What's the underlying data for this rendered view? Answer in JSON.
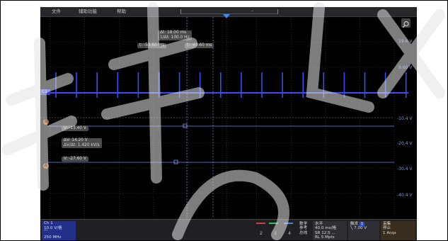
{
  "menu": {
    "file": "文件",
    "edit": "辅助功能",
    "help": "帮助"
  },
  "record_view": {
    "dash": "–"
  },
  "readouts": {
    "delta_t": "Δt:  18.00 ms",
    "inv_delta_t": "1/Δt:  100.0 Hz",
    "t1": "t:   -53.60 ms",
    "t2": "t:   -43.60 ms",
    "v_a": "V:   -13.40 V",
    "delta_v": "ΔV:      14.20 V",
    "dv_dt": "ΔV/Δt: 1.420 kV/s",
    "v_b": "V:   -27.60 V"
  },
  "vscale": [
    "19.6 V",
    "9.60 V",
    "-10.4 V",
    "-20.4 V",
    "-30.4 V",
    "-40.4 V"
  ],
  "markers": {
    "a": "B",
    "b": "A",
    "channel": "C1"
  },
  "channel_box": {
    "title": "Ch 1",
    "scale": "10.0 V/格",
    "coupling": "⌒",
    "bandwidth": "250 MHz"
  },
  "channel_buttons": [
    "2",
    "3",
    "4"
  ],
  "math_refs": {
    "l1": "数学",
    "l2": "参考",
    "l3": "总线"
  },
  "horizontal": {
    "title": "水平",
    "scale": "40.0 ms/格",
    "sample_rate": "SR 12.5 ...",
    "record_length": "RL 5 Mpts"
  },
  "trigger": {
    "title": "触发",
    "badge": "1",
    "slope": "╲",
    "level": "7.00 V"
  },
  "acquisition": {
    "title": "采集",
    "mode": "停止",
    "count": "1 Acqs"
  },
  "colors": {
    "trace": "#3a4cf0",
    "cursor": "#6f8cf0",
    "marker": "#c8621a",
    "channel_box": "#23308a"
  }
}
